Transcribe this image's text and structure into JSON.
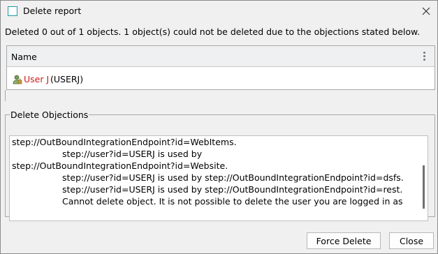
{
  "window": {
    "title": "Delete report",
    "icon": "window-icon",
    "close_icon": "close-icon"
  },
  "summary": "Deleted 0 out of 1 objects. 1 object(s) could not be deleted due to the objections stated below.",
  "list": {
    "column_header": "Name",
    "menu_icon": "kebab-menu-icon",
    "rows": [
      {
        "icon": "user-lock-icon",
        "name": "User J",
        "id": "(USERJ)"
      }
    ]
  },
  "objections": {
    "legend": "Delete Objections",
    "lines": [
      "step://OutBoundIntegrationEndpoint?id=WebItems.",
      "step://user?id=USERJ is used by",
      "step://OutBoundIntegrationEndpoint?id=Website.",
      "step://user?id=USERJ is used by step://OutBoundIntegrationEndpoint?id=dsfs.",
      "step://user?id=USERJ is used by step://OutBoundIntegrationEndpoint?id=rest.",
      "Cannot delete object. It is not possible to delete the user you are logged in as"
    ]
  },
  "buttons": {
    "force_delete": "Force Delete",
    "close": "Close"
  },
  "colors": {
    "accent_icon": "#1e9aa6",
    "user_name": "#d01818"
  }
}
